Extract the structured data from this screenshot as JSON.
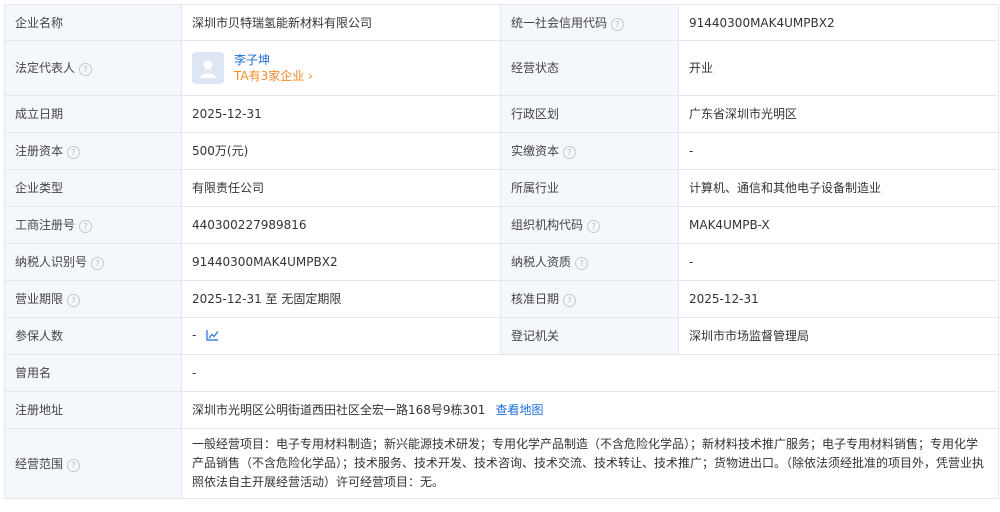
{
  "rows": [
    {
      "l_label": "企业名称",
      "l_value": "深圳市贝特瑞氢能新材料有限公司",
      "r_label": "统一社会信用代码",
      "r_value": "91440300MAK4UMPBX2"
    },
    {
      "l_label": "法定代表人",
      "person_name": "李子坤",
      "person_link": "TA有3家企业",
      "r_label": "经营状态",
      "r_value": "开业"
    },
    {
      "l_label": "成立日期",
      "l_value": "2025-12-31",
      "r_label": "行政区划",
      "r_value": "广东省深圳市光明区"
    },
    {
      "l_label": "注册资本",
      "l_value": "500万(元)",
      "r_label": "实缴资本",
      "r_value": "-"
    },
    {
      "l_label": "企业类型",
      "l_value": "有限责任公司",
      "r_label": "所属行业",
      "r_value": "计算机、通信和其他电子设备制造业"
    },
    {
      "l_label": "工商注册号",
      "l_value": "440300227989816",
      "r_label": "组织机构代码",
      "r_value": "MAK4UMPB-X"
    },
    {
      "l_label": "纳税人识别号",
      "l_value": "91440300MAK4UMPBX2",
      "r_label": "纳税人资质",
      "r_value": "-"
    },
    {
      "l_label": "营业期限",
      "l_value": "2025-12-31 至 无固定期限",
      "r_label": "核准日期",
      "r_value": "2025-12-31"
    },
    {
      "l_label": "参保人数",
      "l_value": "-",
      "r_label": "登记机关",
      "r_value": "深圳市市场监督管理局"
    },
    {
      "l_label": "曾用名",
      "l_value": "-"
    },
    {
      "l_label": "注册地址",
      "l_value": "深圳市光明区公明街道西田社区全宏一路168号9栋301",
      "link": "查看地图"
    },
    {
      "l_label": "经营范围",
      "l_value": "一般经营项目：电子专用材料制造；新兴能源技术研发；专用化学产品制造（不含危险化学品）；新材料技术推广服务；电子专用材料销售；专用化学产品销售（不含危险化学品）；技术服务、技术开发、技术咨询、技术交流、技术转让、技术推广；货物进出口。（除依法须经批准的项目外，凭营业执照依法自主开展经营活动）许可经营项目：无。"
    }
  ],
  "icons": {
    "help": "help-circle-icon",
    "avatar": "avatar-icon",
    "trend": "trend-chart-icon",
    "arrow": "chevron-right-icon"
  },
  "help_glyph": "?",
  "arrow_glyph": "›",
  "colors": {
    "label_bg": "#f4f7fb",
    "border": "#e4e8ee",
    "link": "#1e6fd9",
    "accent": "#f08a2a"
  }
}
